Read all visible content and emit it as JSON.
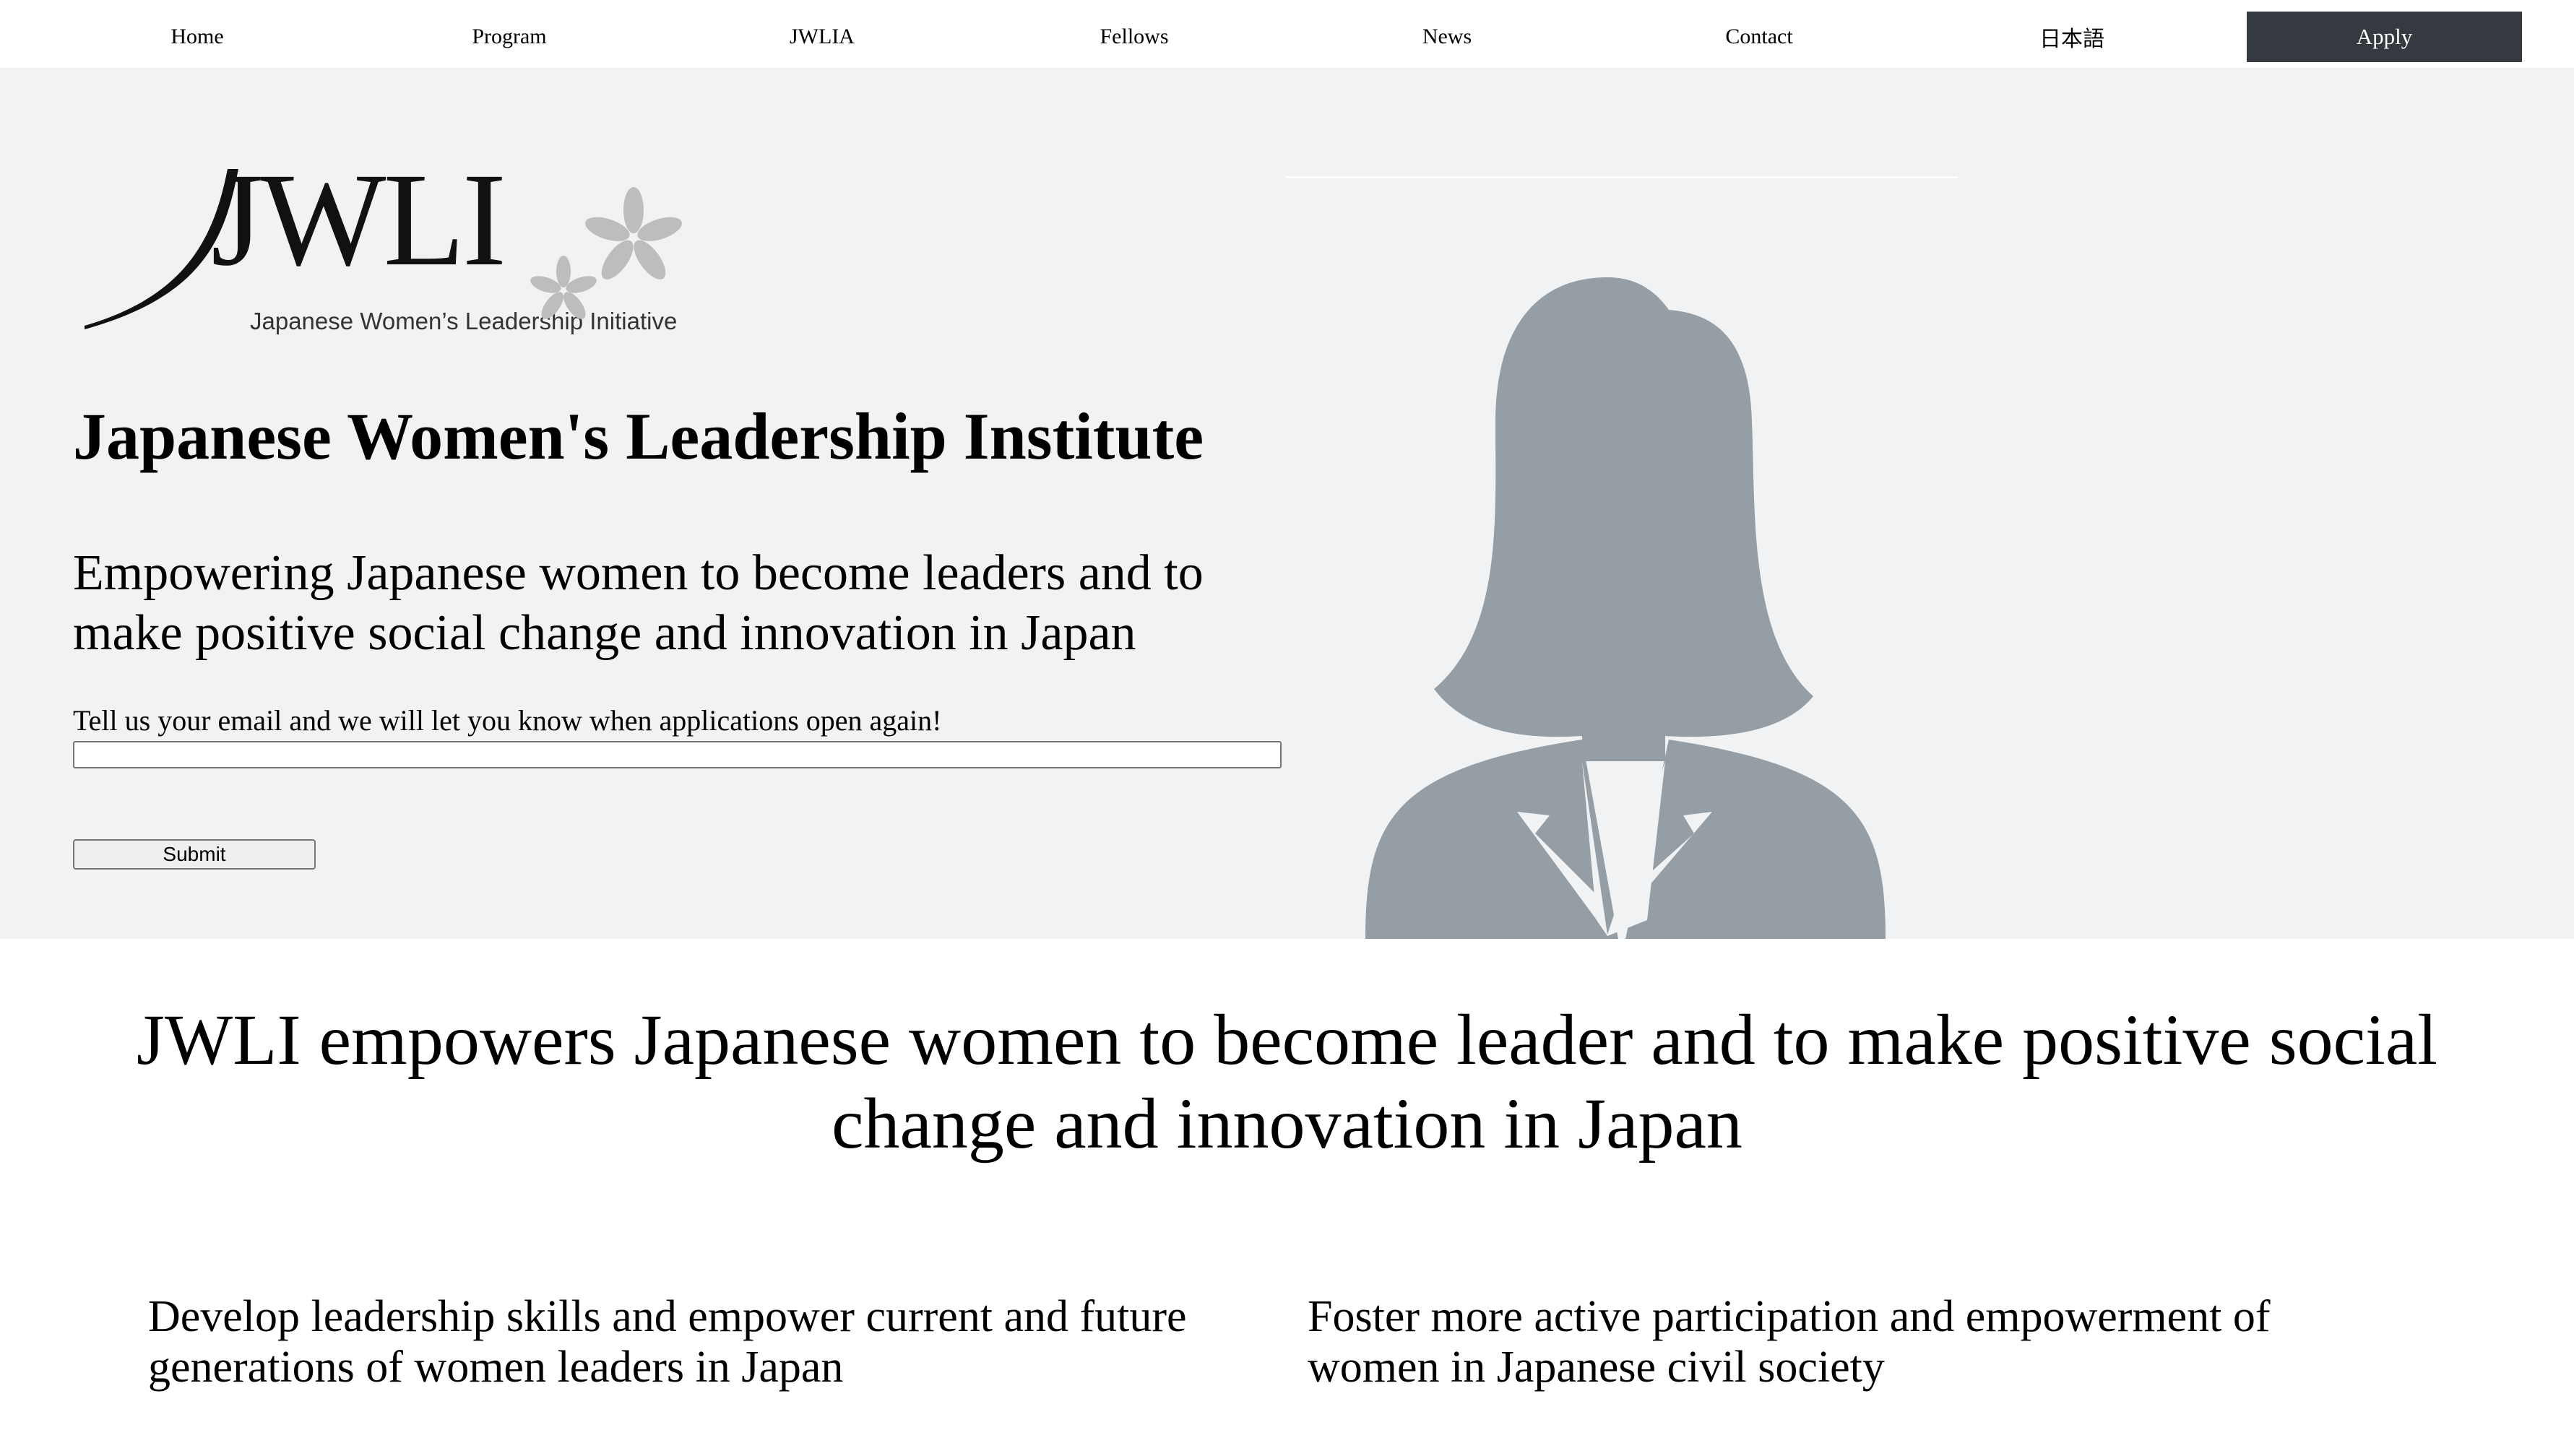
{
  "nav": {
    "items": [
      {
        "label": "Home"
      },
      {
        "label": "Program"
      },
      {
        "label": "JWLIA"
      },
      {
        "label": "Fellows"
      },
      {
        "label": "News"
      },
      {
        "label": "Contact"
      },
      {
        "label": "日本語"
      }
    ],
    "apply_label": "Apply",
    "apply_bg": "#343a40"
  },
  "hero": {
    "logo": {
      "wordmark": "JWLI",
      "tagline": "Japanese Women’s Leadership Initiative",
      "icon": "sakura-blossom-icon"
    },
    "title": "Japanese Women's Leadership Institute",
    "subtitle": "Empowering Japanese women to become leaders and to make positive social change and innovation in Japan",
    "signup": {
      "label": "Tell us your email and we will let you know when applications open again!",
      "email_value": "",
      "submit_label": "Submit"
    },
    "image_icon": "woman-silhouette-icon",
    "background": "#f1f2f4",
    "silhouette_color": "#949ea4"
  },
  "mission": {
    "headline": "JWLI empowers Japanese women to become leader and to make positive social change and innovation in Japan",
    "goals": [
      {
        "text": "Develop leadership skills and empower current and future generations of women leaders in Japan"
      },
      {
        "text": "Foster more active participation and empowerment of women in Japanese civil society"
      }
    ]
  }
}
